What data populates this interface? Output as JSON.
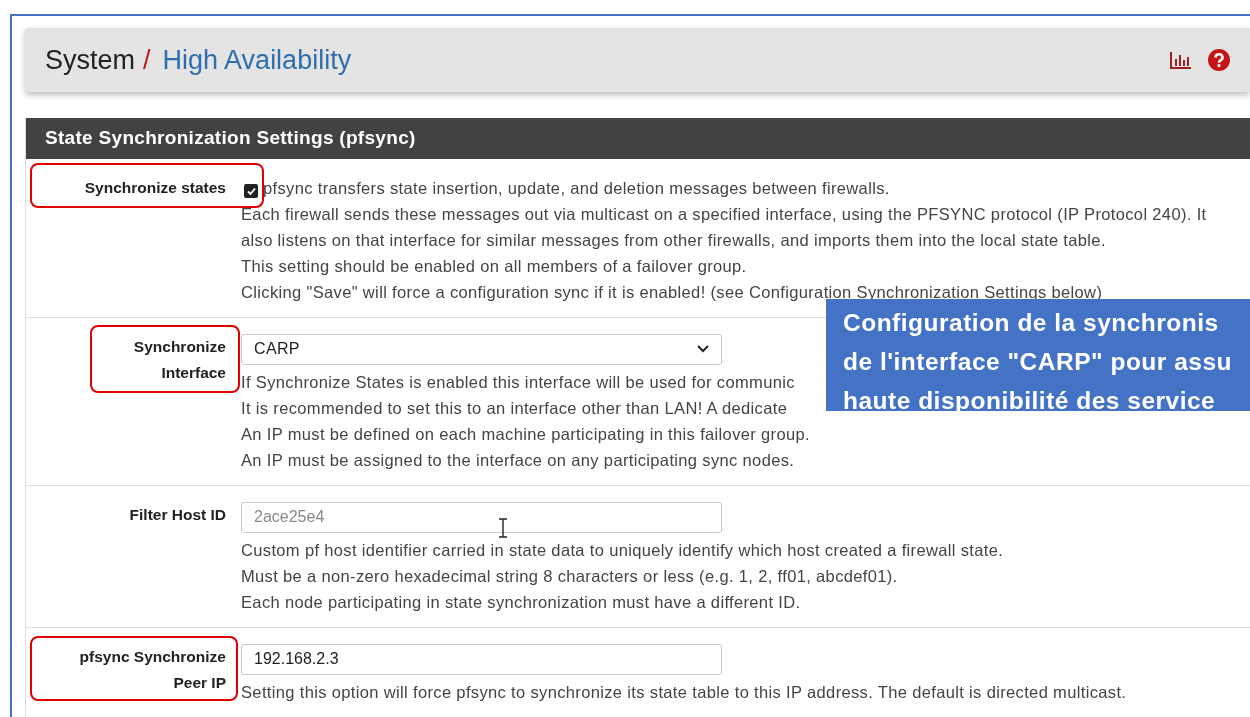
{
  "breadcrumb": {
    "parent": "System",
    "separator": "/",
    "current": "High Availability"
  },
  "section": {
    "title": "State Synchronization Settings (pfsync)"
  },
  "rows": [
    {
      "kind": "checkbox",
      "label": "Synchronize states",
      "highlighted": true,
      "checked": true,
      "inline_text": "pfsync transfers state insertion, update, and deletion messages between firewalls.",
      "help": [
        "Each firewall sends these messages out via multicast on a specified interface, using the PFSYNC protocol (IP Protocol 240). It also listens on that interface for similar messages from other firewalls, and imports them into the local state table.",
        "This setting should be enabled on all members of a failover group.",
        "Clicking \"Save\" will force a configuration sync if it is enabled! (see Configuration Synchronization Settings below)"
      ]
    },
    {
      "kind": "select",
      "label": "Synchronize Interface",
      "highlighted": true,
      "value": "CARP",
      "help": [
        "If Synchronize States is enabled this interface will be used for communic",
        "It is recommended to set this to an interface other than LAN! A dedicate",
        "An IP must be defined on each machine participating in this failover group.",
        "An IP must be assigned to the interface on any participating sync nodes."
      ]
    },
    {
      "kind": "input",
      "label": "Filter Host ID",
      "highlighted": false,
      "placeholder": "2ace25e4",
      "help": [
        "Custom pf host identifier carried in state data to uniquely identify which host created a firewall state.",
        "Must be a non-zero hexadecimal string 8 characters or less (e.g. 1, 2, ff01, abcdef01).",
        "Each node participating in state synchronization must have a different ID."
      ]
    },
    {
      "kind": "input",
      "label": "pfsync Synchronize Peer IP",
      "highlighted": true,
      "value": "192.168.2.3",
      "help": [
        "Setting this option will force pfsync to synchronize its state table to this IP address. The default is directed multicast."
      ]
    }
  ],
  "callout": {
    "lines": [
      "Configuration de la synchronis",
      "de l'interface \"CARP\" pour assu",
      "haute disponibilité des service"
    ]
  }
}
